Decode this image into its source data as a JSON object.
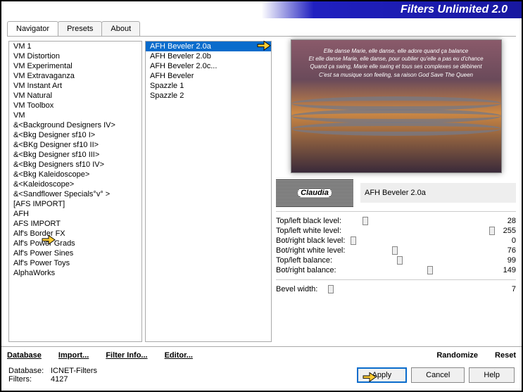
{
  "header": {
    "title": "Filters Unlimited 2.0"
  },
  "tabs": [
    "Navigator",
    "Presets",
    "About"
  ],
  "activeTab": 0,
  "categories": [
    "VM 1",
    "VM Distortion",
    "VM Experimental",
    "VM Extravaganza",
    "VM Instant Art",
    "VM Natural",
    "VM Toolbox",
    "VM",
    "&<Background Designers IV>",
    "&<Bkg Designer sf10 I>",
    "&<BKg Designer sf10 II>",
    "&<Bkg Designer sf10 III>",
    "&<Bkg Designers sf10 IV>",
    "&<Bkg Kaleidoscope>",
    "&<Kaleidoscope>",
    "&<Sandflower Specials°v° >",
    "[AFS IMPORT]",
    "AFH",
    "AFS IMPORT",
    "Alf's Border FX",
    "Alf's Power Grads",
    "Alf's Power Sines",
    "Alf's Power Toys",
    "AlphaWorks"
  ],
  "selectedCategory": "AFH",
  "filters": [
    "AFH Beveler 2.0a",
    "AFH Beveler 2.0b",
    "AFH Beveler 2.0c...",
    "AFH Beveler",
    "Spazzle 1",
    "Spazzle 2"
  ],
  "selectedFilterIndex": 0,
  "preview": {
    "lines": [
      "Elle danse Marie, elle danse, elle adore quand ça balance",
      "Et elle danse Marie, elle danse, pour oublier qu'elle a pas eu d'chance",
      "Quand ça swing, Marie elle swing et tous ses complexes se débinent",
      "C'est sa musique son feeling, sa raison God Save The Queen"
    ]
  },
  "logo": {
    "text": "Claudia"
  },
  "activeFilterName": "AFH Beveler 2.0a",
  "params": [
    {
      "label": "Top/left black level:",
      "value": 28,
      "pos": 11
    },
    {
      "label": "Top/left white level:",
      "value": 255,
      "pos": 100
    },
    {
      "label": "Bot/right black level:",
      "value": 0,
      "pos": 0
    },
    {
      "label": "Bot/right white level:",
      "value": 76,
      "pos": 30
    },
    {
      "label": "Top/left balance:",
      "value": 99,
      "pos": 39
    },
    {
      "label": "Bot/right balance:",
      "value": 149,
      "pos": 58
    }
  ],
  "params2": [
    {
      "label": "Bevel width:",
      "value": 7,
      "pos": 3
    }
  ],
  "bottomLinks": [
    "Database",
    "Import...",
    "Filter Info...",
    "Editor..."
  ],
  "bottomRight": [
    "Randomize",
    "Reset"
  ],
  "status": {
    "dbLabel": "Database:",
    "dbValue": "ICNET-Filters",
    "filtersLabel": "Filters:",
    "filtersValue": "4127"
  },
  "buttons": {
    "apply": "Apply",
    "cancel": "Cancel",
    "help": "Help"
  }
}
